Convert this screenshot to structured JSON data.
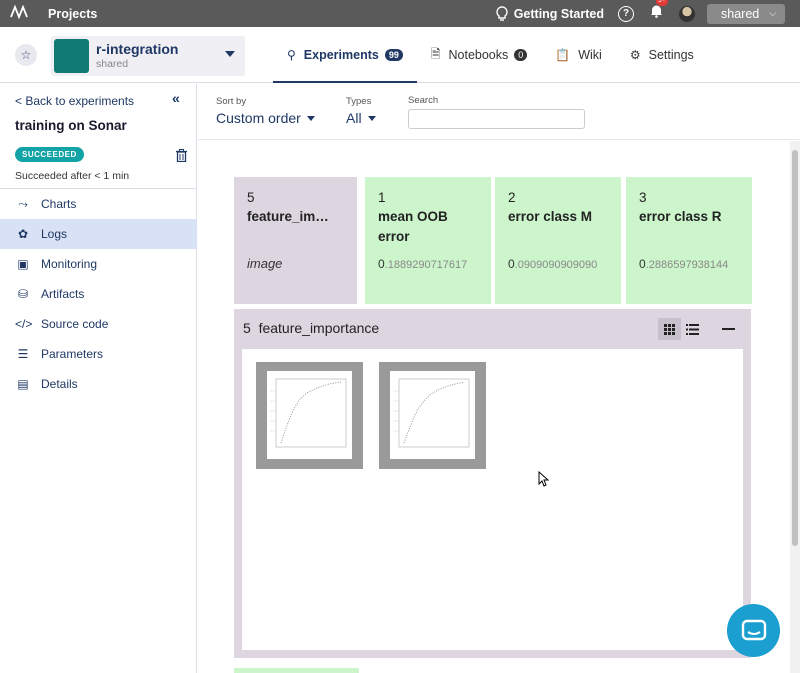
{
  "topbar": {
    "title": "Projects",
    "getting_started": "Getting Started",
    "help": "?",
    "notif_badge": "9+",
    "org_label": "shared"
  },
  "project": {
    "name": "r-integration",
    "org": "shared",
    "color": "#127a74"
  },
  "tabs": [
    {
      "label": "Experiments",
      "count": "99",
      "active": true
    },
    {
      "label": "Notebooks",
      "count": "0"
    },
    {
      "label": "Wiki"
    },
    {
      "label": "Settings"
    }
  ],
  "sidebar": {
    "back_label": "< Back to experiments",
    "run_title": "training on Sonar",
    "status_label": "SUCCEEDED",
    "status_detail": "Succeeded after < 1 min",
    "items": [
      {
        "label": "Charts",
        "icon": "chart-icon"
      },
      {
        "label": "Logs",
        "icon": "logs-icon",
        "active": true
      },
      {
        "label": "Monitoring",
        "icon": "chip-icon"
      },
      {
        "label": "Artifacts",
        "icon": "database-icon"
      },
      {
        "label": "Source code",
        "icon": "code-icon"
      },
      {
        "label": "Parameters",
        "icon": "sliders-icon"
      },
      {
        "label": "Details",
        "icon": "details-icon"
      }
    ]
  },
  "filters": {
    "sort_label": "Sort by",
    "sort_value": "Custom order",
    "types_label": "Types",
    "types_value": "All",
    "search_label": "Search",
    "search_value": ""
  },
  "channels": [
    {
      "num": "5",
      "name": "feature_im…",
      "type": "image"
    },
    {
      "num": "1",
      "name": "mean OOB error",
      "value_lead": "0",
      "value_rest": ".1889290717617"
    },
    {
      "num": "2",
      "name": "error class M",
      "value_lead": "0",
      "value_rest": ".0909090909090"
    },
    {
      "num": "3",
      "name": "error class R",
      "value_lead": "0",
      "value_rest": ".2886597938144"
    }
  ],
  "panel": {
    "num": "5",
    "title": "feature_importance"
  },
  "colors": {
    "accent": "#1f3864",
    "metric_bg": "#ccf5cc",
    "image_bg": "#ddd5e0",
    "status": "#12a3a6"
  }
}
